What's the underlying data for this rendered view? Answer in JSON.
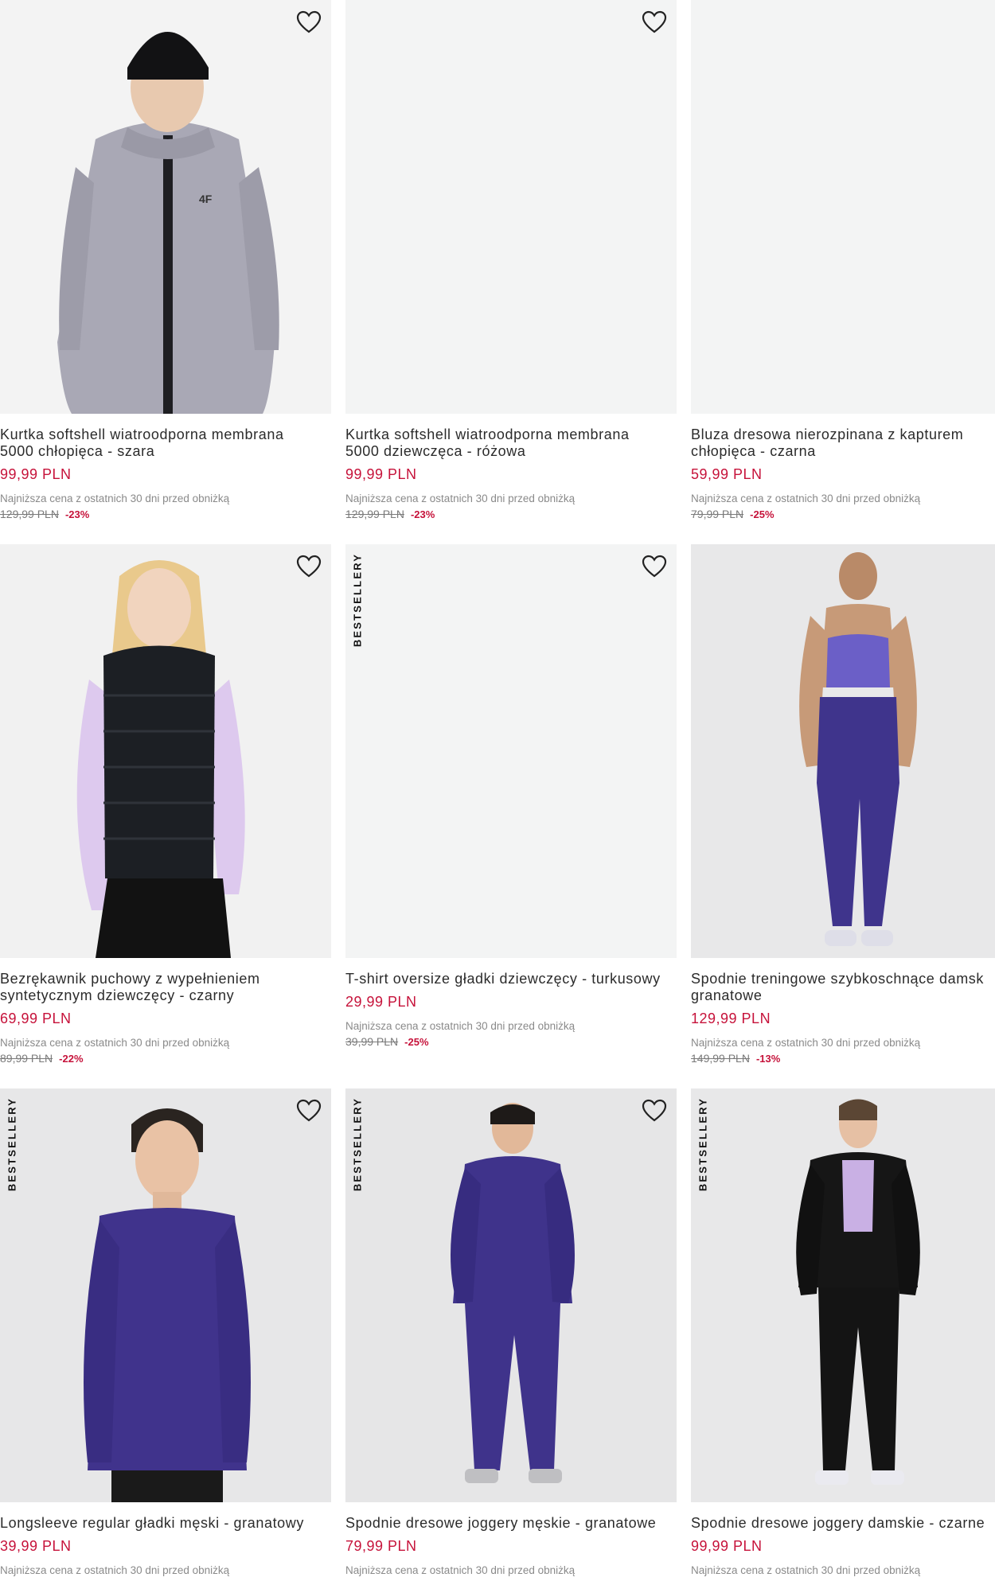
{
  "products": [
    {
      "name": "Kurtka softshell wiatroodporna membrana\n5000 chłopięca - szara",
      "price": "99,99 PLN",
      "lowest_label": "Najniższa cena z ostatnich 30 dni przed obniżką",
      "old_price": "129,99 PLN",
      "discount": "-23%",
      "badge": "",
      "image": "boy-gray-softshell-jacket"
    },
    {
      "name": "Kurtka softshell wiatroodporna membrana\n5000 dziewczęca - różowa",
      "price": "99,99 PLN",
      "lowest_label": "Najniższa cena z ostatnich 30 dni przed obniżką",
      "old_price": "129,99 PLN",
      "discount": "-23%",
      "badge": "",
      "image": "blank"
    },
    {
      "name": "Bluza dresowa nierozpinana z kapturem\nchłopięca - czarna",
      "price": "59,99 PLN",
      "lowest_label": "Najniższa cena z ostatnich 30 dni przed obniżką",
      "old_price": "79,99 PLN",
      "discount": "-25%",
      "badge": "",
      "image": "blank"
    },
    {
      "name": "Bezrękawnik puchowy z wypełnieniem\nsyntetycznym dziewczęcy - czarny",
      "price": "69,99 PLN",
      "lowest_label": "Najniższa cena z ostatnich 30 dni przed obniżką",
      "old_price": "89,99 PLN",
      "discount": "-22%",
      "badge": "",
      "image": "girl-black-puffer-vest"
    },
    {
      "name": "T-shirt oversize gładki dziewczęcy - turkusowy",
      "price": "29,99 PLN",
      "lowest_label": "Najniższa cena z ostatnich 30 dni przed obniżką",
      "old_price": "39,99 PLN",
      "discount": "-25%",
      "badge": "BESTSELLERY",
      "image": "blank"
    },
    {
      "name": "Spodnie treningowe szybkoschnące damsk\ngranatowe",
      "price": "129,99 PLN",
      "lowest_label": "Najniższa cena z ostatnich 30 dni przed obniżką",
      "old_price": "149,99 PLN",
      "discount": "-13%",
      "badge": "",
      "image": "woman-navy-training-pants"
    },
    {
      "name": "Longsleeve regular gładki męski - granatowy",
      "price": "39,99 PLN",
      "lowest_label": "Najniższa cena z ostatnich 30 dni przed obniżką",
      "old_price": "",
      "discount": "",
      "badge": "BESTSELLERY",
      "image": "man-navy-longsleeve"
    },
    {
      "name": "Spodnie dresowe joggery męskie - granatowe",
      "price": "79,99 PLN",
      "lowest_label": "Najniższa cena z ostatnich 30 dni przed obniżką",
      "old_price": "",
      "discount": "",
      "badge": "BESTSELLERY",
      "image": "man-navy-tracksuit"
    },
    {
      "name": "Spodnie dresowe joggery damskie - czarne",
      "price": "99,99 PLN",
      "lowest_label": "Najniższa cena z ostatnich 30 dni przed obniżką",
      "old_price": "",
      "discount": "",
      "badge": "BESTSELLERY",
      "image": "woman-black-joggers"
    }
  ],
  "icons": {
    "favorite": "heart-outline-icon"
  },
  "colors": {
    "price": "#c6123a",
    "image_bg": "#f3f4f4",
    "navy": "#3f348c"
  }
}
